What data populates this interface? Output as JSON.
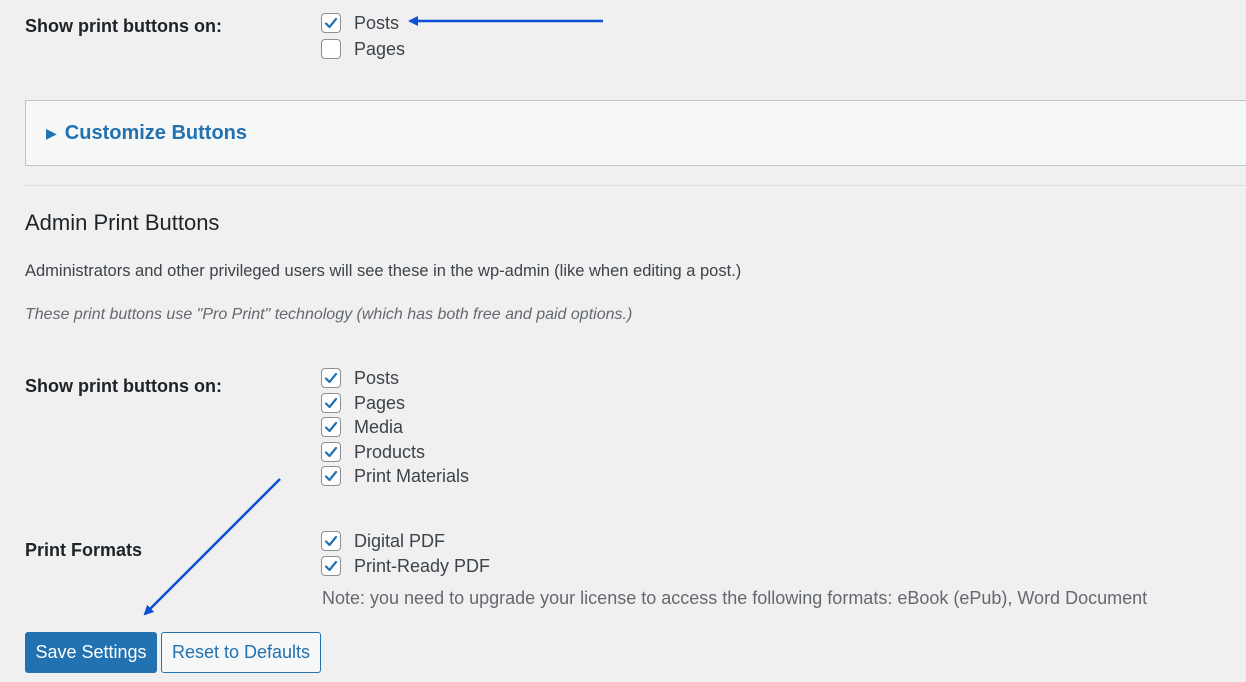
{
  "frontend": {
    "label": "Show print buttons on:",
    "options": [
      {
        "label": "Posts",
        "checked": true
      },
      {
        "label": "Pages",
        "checked": false
      }
    ]
  },
  "customize": {
    "toggle_icon": "▶",
    "title": "Customize Buttons"
  },
  "admin": {
    "title": "Admin Print Buttons",
    "description": "Administrators and other privileged users will see these in the wp-admin (like when editing a post.)",
    "note": "These print buttons use \"Pro Print\" technology (which has both free and paid options.)",
    "label": "Show print buttons on:",
    "options": [
      {
        "label": "Posts",
        "checked": true
      },
      {
        "label": "Pages",
        "checked": true
      },
      {
        "label": "Media",
        "checked": true
      },
      {
        "label": "Products",
        "checked": true
      },
      {
        "label": "Print Materials",
        "checked": true
      }
    ]
  },
  "formats": {
    "label": "Print Formats",
    "options": [
      {
        "label": "Digital PDF",
        "checked": true
      },
      {
        "label": "Print-Ready PDF",
        "checked": true
      }
    ],
    "note": "Note: you need to upgrade your license to access the following formats: eBook (ePub), Word Document"
  },
  "actions": {
    "save_label": "Save Settings",
    "reset_label": "Reset to Defaults"
  },
  "colors": {
    "accent": "#2271b1",
    "checkmark": "#2271b1",
    "annotation_arrow": "#0a4fd6",
    "background": "#f0f0f1"
  }
}
